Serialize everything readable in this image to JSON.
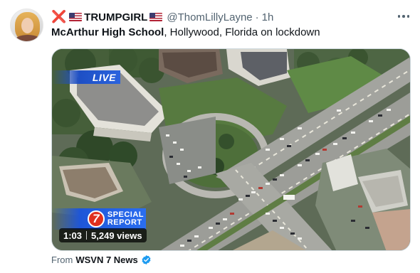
{
  "tweet": {
    "author": {
      "prefix_symbol": "❌",
      "display_name": "TRUMPGIRL",
      "handle": "@ThomLillyLayne",
      "separator": "·",
      "time": "1h"
    },
    "text_bold": "McArthur High School",
    "text_rest": ", Hollywood, Florida on lockdown",
    "media": {
      "live_label": "LIVE",
      "channel_logo": "7",
      "special_report_line1": "SPECIAL",
      "special_report_line2": "REPORT",
      "duration": "1:03",
      "views": "5,249 views"
    },
    "source": {
      "prefix": "From",
      "name": "WSVN 7 News"
    },
    "icons": {
      "more": "more-horizontal-icon",
      "verified": "verified-badge-icon",
      "flag": "us-flag-icon"
    },
    "colors": {
      "live_blue": "#2a63de",
      "logo_red": "#e0301e",
      "verified_blue": "#1d9bf0",
      "x_red": "#e0245e"
    }
  }
}
